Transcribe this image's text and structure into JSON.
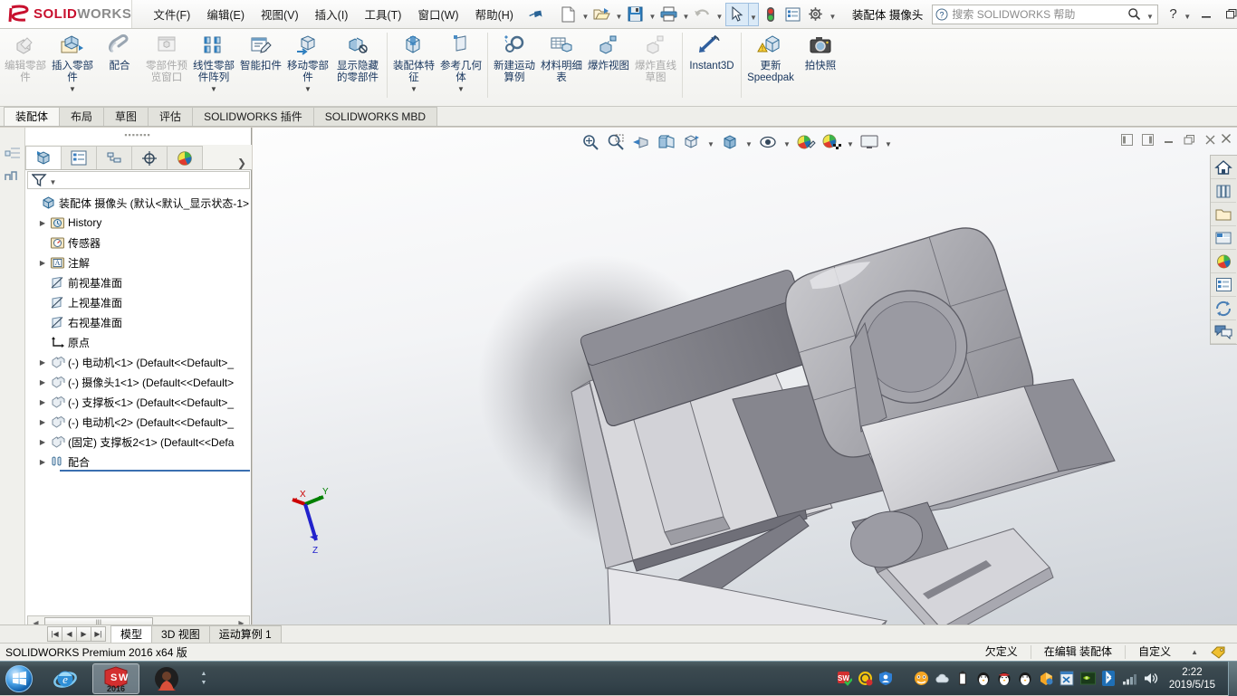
{
  "titlebar": {
    "logo": {
      "ds": "3S",
      "sw": "SOLID",
      "works": "WORKS"
    },
    "menu": [
      "文件(F)",
      "编辑(E)",
      "视图(V)",
      "插入(I)",
      "工具(T)",
      "窗口(W)",
      "帮助(H)"
    ],
    "pin_icon": "pushpin-icon",
    "doc_title": "装配体 摄像头",
    "search_placeholder": "搜索 SOLIDWORKS 帮助",
    "help_label": "?",
    "quick_tools": [
      "new-document-icon",
      "open-document-icon",
      "save-icon",
      "print-icon",
      "undo-icon",
      "select-icon",
      "rebuild-icon",
      "options-list-icon",
      "settings-gear-icon"
    ],
    "window_buttons": [
      "minimize",
      "restore",
      "close"
    ]
  },
  "ribbon": {
    "groups": [
      {
        "buttons": [
          {
            "label": "编辑零部件",
            "icon": "edit-component-icon",
            "disabled": true,
            "dropdown": false
          },
          {
            "label": "插入零部件",
            "icon": "insert-component-icon",
            "disabled": false,
            "dropdown": true
          },
          {
            "label": "配合",
            "icon": "mate-icon",
            "disabled": false,
            "dropdown": false
          },
          {
            "label": "零部件预览窗口",
            "icon": "component-preview-window-icon",
            "disabled": true,
            "dropdown": false
          },
          {
            "label": "线性零部件阵列",
            "icon": "linear-component-pattern-icon",
            "disabled": false,
            "dropdown": true
          },
          {
            "label": "智能扣件",
            "icon": "smart-fasteners-icon",
            "disabled": false,
            "dropdown": false
          },
          {
            "label": "移动零部件",
            "icon": "move-component-icon",
            "disabled": false,
            "dropdown": true
          },
          {
            "label": "显示隐藏的零部件",
            "icon": "show-hidden-components-icon",
            "disabled": false,
            "dropdown": false
          }
        ]
      },
      {
        "buttons": [
          {
            "label": "装配体特征",
            "icon": "assembly-features-icon",
            "disabled": false,
            "dropdown": true
          },
          {
            "label": "参考几何体",
            "icon": "reference-geometry-icon",
            "disabled": false,
            "dropdown": true
          }
        ]
      },
      {
        "buttons": [
          {
            "label": "新建运动算例",
            "icon": "new-motion-study-icon",
            "disabled": false,
            "dropdown": false
          },
          {
            "label": "材料明细表",
            "icon": "bill-of-materials-icon",
            "disabled": false,
            "dropdown": false
          },
          {
            "label": "爆炸视图",
            "icon": "exploded-view-icon",
            "disabled": false,
            "dropdown": false
          },
          {
            "label": "爆炸直线草图",
            "icon": "explode-line-sketch-icon",
            "disabled": true,
            "dropdown": false
          }
        ]
      },
      {
        "buttons": [
          {
            "label": "Instant3D",
            "icon": "instant3d-icon",
            "disabled": false,
            "dropdown": false
          }
        ]
      },
      {
        "buttons": [
          {
            "label": "更新 Speedpak",
            "icon": "update-speedpak-icon",
            "disabled": false,
            "dropdown": false
          },
          {
            "label": "拍快照",
            "icon": "capture-snapshot-icon",
            "disabled": false,
            "dropdown": false
          }
        ]
      }
    ]
  },
  "command_tabs": {
    "items": [
      "装配体",
      "布局",
      "草图",
      "评估",
      "SOLIDWORKS 插件",
      "SOLIDWORKS MBD"
    ],
    "active_index": 0
  },
  "feature_manager": {
    "tabs": [
      "feature-tree-icon",
      "property-manager-icon",
      "configuration-manager-icon",
      "dimxpert-icon",
      "display-manager-icon"
    ],
    "active_tab_index": 0,
    "more_icon": "chevron-right-icon",
    "filter_icon": "filter-icon",
    "tree": [
      {
        "label": "装配体 摄像头  (默认<默认_显示状态-1>",
        "icon": "assembly-icon",
        "indent": 0,
        "expander": ""
      },
      {
        "label": "History",
        "icon": "history-icon",
        "indent": 1,
        "expander": "▶"
      },
      {
        "label": "传感器",
        "icon": "sensors-icon",
        "indent": 1,
        "expander": ""
      },
      {
        "label": "注解",
        "icon": "annotations-icon",
        "indent": 1,
        "expander": "▶"
      },
      {
        "label": "前视基准面",
        "icon": "plane-icon",
        "indent": 1,
        "expander": ""
      },
      {
        "label": "上视基准面",
        "icon": "plane-icon",
        "indent": 1,
        "expander": ""
      },
      {
        "label": "右视基准面",
        "icon": "plane-icon",
        "indent": 1,
        "expander": ""
      },
      {
        "label": "原点",
        "icon": "origin-icon",
        "indent": 1,
        "expander": ""
      },
      {
        "label": "(-) 电动机<1>  (Default<<Default>_",
        "icon": "component-icon",
        "indent": 1,
        "expander": "▶"
      },
      {
        "label": "(-) 摄像头1<1>  (Default<<Default>",
        "icon": "component-icon",
        "indent": 1,
        "expander": "▶"
      },
      {
        "label": "(-) 支撑板<1>  (Default<<Default>_",
        "icon": "component-icon",
        "indent": 1,
        "expander": "▶"
      },
      {
        "label": "(-) 电动机<2>  (Default<<Default>_",
        "icon": "component-icon",
        "indent": 1,
        "expander": "▶"
      },
      {
        "label": "(固定) 支撑板2<1>  (Default<<Defa",
        "icon": "component-icon",
        "indent": 1,
        "expander": "▶"
      },
      {
        "label": "配合",
        "icon": "mates-folder-icon",
        "indent": 1,
        "expander": "▶"
      }
    ],
    "hscroll": {
      "left_arrow": "◀",
      "right_arrow": "▶",
      "thumb_grip": "llI"
    }
  },
  "view_toolbar": {
    "buttons": [
      "zoom-to-fit-icon",
      "zoom-to-area-icon",
      "previous-view-icon",
      "section-view-icon",
      "view-orientation-icon",
      "display-style-icon",
      "hide-show-items-icon",
      "edit-appearance-icon",
      "apply-scene-icon",
      "view-settings-icon"
    ]
  },
  "document_window_controls": [
    "restore-left-icon",
    "restore-right-icon",
    "minimize-icon",
    "restore-icon",
    "close-icon"
  ],
  "task_pane": {
    "close_icon": "close-icon",
    "buttons": [
      "solidworks-resources-icon",
      "design-library-icon",
      "file-explorer-icon",
      "view-palette-icon",
      "appearances-scenes-icon",
      "custom-properties-icon",
      "solidworks-forum-icon",
      "sw-chat-icon"
    ]
  },
  "triad": {
    "x_label": "X",
    "y_label": "Y",
    "z_label": "Z"
  },
  "bottom_tabs": {
    "nav": [
      "◀◀",
      "◀",
      "▶",
      "▶▶"
    ],
    "items": [
      "模型",
      "3D 视图",
      "运动算例 1"
    ],
    "active_index": 0
  },
  "status_bar": {
    "left": "SOLIDWORKS Premium 2016 x64 版",
    "state": "欠定义",
    "editing": "在编辑 装配体",
    "custom": "自定义",
    "caret": "▲",
    "badge_icon": "tag-icon"
  },
  "taskbar": {
    "start_icon": "windows-start-icon",
    "items": [
      {
        "icon": "internet-explorer-icon",
        "active": false
      },
      {
        "icon": "solidworks-2016-icon",
        "label": "2016",
        "active": true
      },
      {
        "icon": "photo-app-icon",
        "active": false
      }
    ],
    "tray_icons": [
      "sw-tray-icon",
      "ccb-tray-icon",
      "security-shield-icon",
      "thunder-download-icon",
      "onedrive-icon",
      "battery-icon",
      "qq-icon",
      "qq-icon",
      "qq-icon",
      "wps-icon",
      "excel-icon",
      "nvidia-icon",
      "bluetooth-icon",
      "network-icon",
      "volume-icon"
    ],
    "time": "2:22",
    "date": "2019/5/15"
  }
}
